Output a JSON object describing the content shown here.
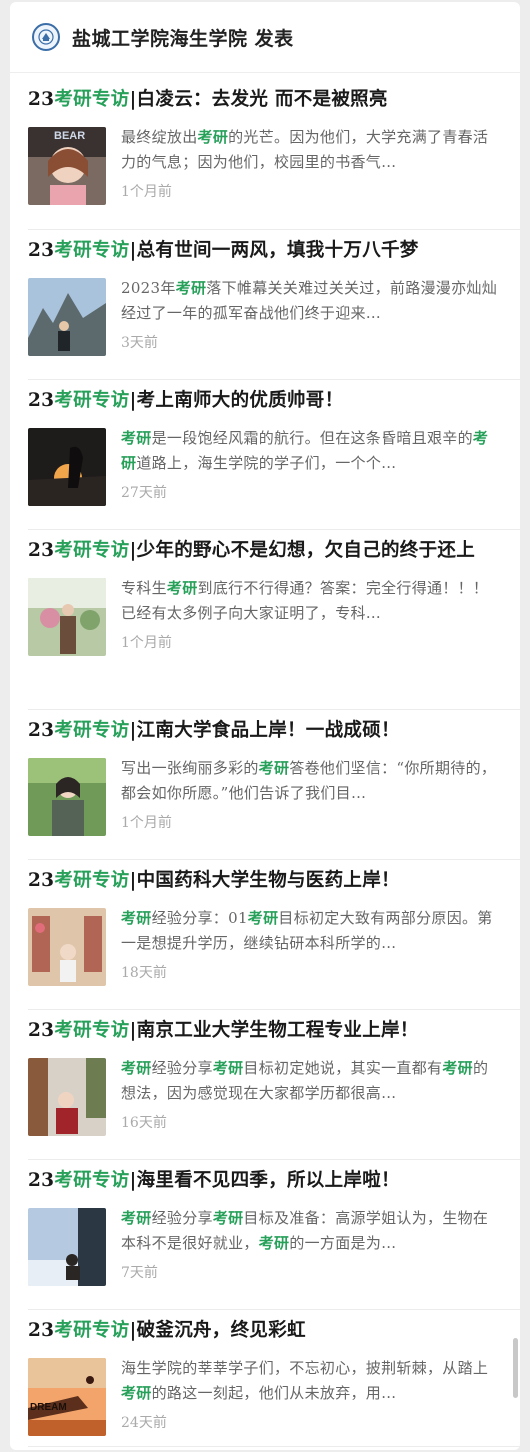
{
  "header": {
    "title": "盐城工学院海生学院 发表",
    "icon": "school-logo-icon"
  },
  "accent_color": "#27a05a",
  "articles": [
    {
      "title_pre": "23",
      "title_hl": "考研专访",
      "title_post": "|白凌云：去发光 而不是被照亮",
      "snippet": [
        [
          "最终绽放出",
          false
        ],
        [
          "考研",
          true
        ],
        [
          "的光芒。因为他们，大学充满了青春活力的气息；因为他们，校园里的书香气…",
          false
        ]
      ],
      "time": "1个月前",
      "thumb_text": "BEAR"
    },
    {
      "title_pre": "23",
      "title_hl": "考研专访",
      "title_post": "|总有世间一两风，填我十万八千梦",
      "snippet": [
        [
          "2023年",
          false
        ],
        [
          "考研",
          true
        ],
        [
          "落下帷幕关关难过关关过，前路漫漫亦灿灿经过了一年的孤军奋战他们终于迎来…",
          false
        ]
      ],
      "time": "3天前",
      "thumb_text": ""
    },
    {
      "title_pre": "23",
      "title_hl": "考研专访",
      "title_post": "|考上南师大的优质帅哥！",
      "snippet": [
        [
          "考研",
          true
        ],
        [
          "是一段饱经风霜的航行。但在这条昏暗且艰辛的",
          false
        ],
        [
          "考研",
          true
        ],
        [
          "道路上，海生学院的学子们，一个个…",
          false
        ]
      ],
      "time": "27天前",
      "thumb_text": ""
    },
    {
      "title_pre": "23",
      "title_hl": "考研专访",
      "title_post": "|少年的野心不是幻想，欠自己的终于还上",
      "snippet": [
        [
          "专科生",
          false
        ],
        [
          "考研",
          true
        ],
        [
          "到底行不行得通？答案：完全行得通！！！已经有太多例子向大家证明了，专科…",
          false
        ]
      ],
      "time": "1个月前",
      "thumb_text": ""
    },
    {
      "title_pre": "23",
      "title_hl": "考研专访",
      "title_post": "|江南大学食品上岸！一战成硕！",
      "snippet": [
        [
          "写出一张绚丽多彩的",
          false
        ],
        [
          "考研",
          true
        ],
        [
          "答卷他们坚信：“你所期待的，都会如你所愿。”他们告诉了我们目…",
          false
        ]
      ],
      "time": "1个月前",
      "thumb_text": ""
    },
    {
      "title_pre": "23",
      "title_hl": "考研专访",
      "title_post": "|中国药科大学生物与医药上岸！",
      "snippet": [
        [
          "考研",
          true
        ],
        [
          "经验分享：01",
          false
        ],
        [
          "考研",
          true
        ],
        [
          "目标初定大致有两部分原因。第一是想提升学历，继续钻研本科所学的…",
          false
        ]
      ],
      "time": "18天前",
      "thumb_text": ""
    },
    {
      "title_pre": "23",
      "title_hl": "考研专访",
      "title_post": "|南京工业大学生物工程专业上岸！",
      "snippet": [
        [
          "考研",
          true
        ],
        [
          "经验分享",
          false
        ],
        [
          "考研",
          true
        ],
        [
          "目标初定她说，其实一直都有",
          false
        ],
        [
          "考研",
          true
        ],
        [
          "的想法，因为感觉现在大家都学历都很高…",
          false
        ]
      ],
      "time": "16天前",
      "thumb_text": ""
    },
    {
      "title_pre": "23",
      "title_hl": "考研专访",
      "title_post": "|海里看不见四季，所以上岸啦！",
      "snippet": [
        [
          "考研",
          true
        ],
        [
          "经验分享",
          false
        ],
        [
          "考研",
          true
        ],
        [
          "目标及准备：高源学姐认为，生物在本科不是很好就业，",
          false
        ],
        [
          "考研",
          true
        ],
        [
          "的一方面是为…",
          false
        ]
      ],
      "time": "7天前",
      "thumb_text": ""
    },
    {
      "title_pre": "23",
      "title_hl": "考研专访",
      "title_post": "|破釜沉舟，终见彩虹",
      "snippet": [
        [
          "海生学院的莘莘学子们，不忘初心，披荆斩棘，从踏上",
          false
        ],
        [
          "考研",
          true
        ],
        [
          "的路这一刻起，他们从未放弃，用…",
          false
        ]
      ],
      "time": "24天前",
      "thumb_text": "DREAM"
    }
  ]
}
